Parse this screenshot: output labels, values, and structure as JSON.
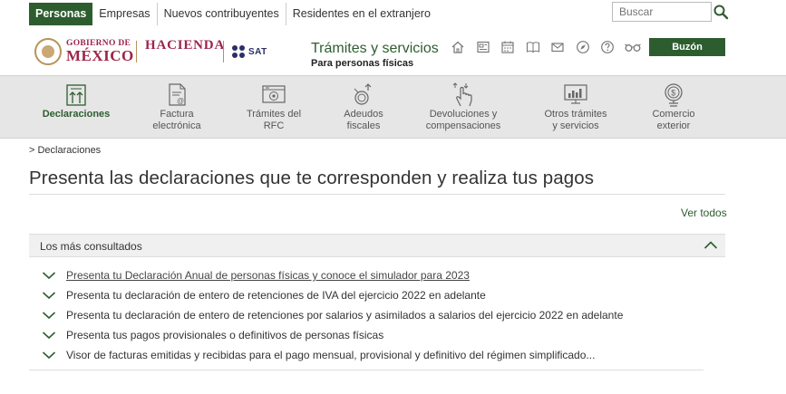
{
  "topnav": {
    "items": [
      {
        "label": "Personas",
        "active": true
      },
      {
        "label": "Empresas",
        "active": false
      },
      {
        "label": "Nuevos contribuyentes",
        "active": false
      },
      {
        "label": "Residentes en el extranjero",
        "active": false
      }
    ],
    "search_placeholder": "Buscar"
  },
  "header": {
    "gob_line1": "GOBIERNO DE",
    "gob_line2": "MÉXICO",
    "hacienda": "HACIENDA",
    "sat": "SAT",
    "tramites_title": "Trámites y servicios",
    "tramites_sub": "Para personas físicas",
    "buzon_label": "Buzón Tributario",
    "icons": [
      "home-icon",
      "news-icon",
      "calendar-icon",
      "book-icon",
      "mail-icon",
      "compass-icon",
      "help-icon",
      "glasses-icon"
    ]
  },
  "mainnav": {
    "items": [
      {
        "line1": "Declaraciones",
        "line2": "",
        "active": true
      },
      {
        "line1": "Factura",
        "line2": "electrónica",
        "active": false
      },
      {
        "line1": "Trámites del",
        "line2": "RFC",
        "active": false
      },
      {
        "line1": "Adeudos",
        "line2": "fiscales",
        "active": false
      },
      {
        "line1": "Devoluciones y",
        "line2": "compensaciones",
        "active": false
      },
      {
        "line1": "Otros trámites",
        "line2": "y servicios",
        "active": false
      },
      {
        "line1": "Comercio",
        "line2": "exterior",
        "active": false
      }
    ]
  },
  "content": {
    "breadcrumb": "> Declaraciones",
    "title": "Presenta las declaraciones que te corresponden y realiza tus pagos",
    "ver_todos": "Ver todos",
    "panel_title": "Los más consultados",
    "items": [
      "Presenta tu Declaración Anual de personas físicas y conoce el simulador para 2023",
      "Presenta tu declaración de entero de retenciones de IVA del ejercicio 2022 en adelante",
      "Presenta tu declaración de entero de retenciones por salarios y asimilados a salarios del ejercicio 2022 en adelante",
      "Presenta tus pagos provisionales o definitivos de personas físicas",
      "Visor de facturas emitidas y recibidas para el pago mensual, provisional y definitivo del régimen simplificado..."
    ]
  },
  "colors": {
    "primary_green": "#2d5d2f",
    "gob_red": "#9d2449",
    "gold": "#b8925a",
    "sat_blue": "#2a2f66",
    "nav_bg": "#e6e6e6"
  }
}
